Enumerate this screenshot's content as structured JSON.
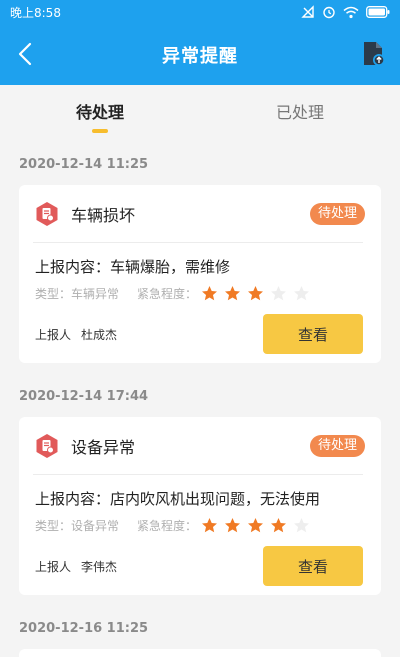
{
  "status_bar": {
    "time": "晚上8:58"
  },
  "header": {
    "title": "异常提醒"
  },
  "tabs": [
    {
      "label": "待处理",
      "active": true
    },
    {
      "label": "已处理",
      "active": false
    }
  ],
  "records": [
    {
      "date": "2020-12-14 11:25",
      "title": "车辆损坏",
      "status": "待处理",
      "content": "上报内容：车辆爆胎，需维修",
      "type_text": "类型：车辆异常",
      "urgency_label": "紧急程度：",
      "urgency_stars": 3,
      "urgency_max": 5,
      "reporter_label": "上报人",
      "reporter_name": "杜成杰",
      "view_label": "查看"
    },
    {
      "date": "2020-12-14 17:44",
      "title": "设备异常",
      "status": "待处理",
      "content": "上报内容：店内吹风机出现问题，无法使用",
      "type_text": "类型：设备异常",
      "urgency_label": "紧急程度：",
      "urgency_stars": 4,
      "urgency_max": 5,
      "reporter_label": "上报人",
      "reporter_name": "李伟杰",
      "view_label": "查看"
    },
    {
      "date": "2020-12-16 11:25"
    }
  ],
  "colors": {
    "header_bg": "#1ea1ee",
    "badge": "#f2894e",
    "star_on": "#f07a24",
    "star_off": "#eeeeee",
    "button": "#f7c843",
    "icon": "#e15a5a",
    "indicator": "#f7bd2d"
  }
}
